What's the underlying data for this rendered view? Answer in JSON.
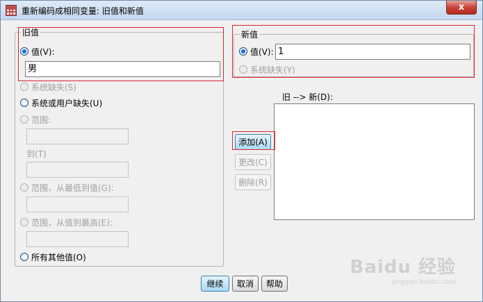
{
  "window": {
    "title": "重新编码成相同变量: 旧值和新值",
    "close_label": "x"
  },
  "old_value": {
    "legend": "旧值",
    "value_label": "值(V):",
    "value_input": "男",
    "system_missing_label": "系统缺失(S)",
    "system_or_user_missing_label": "系统或用户缺失(U)",
    "range_label": "范围:",
    "range_to_label": "到(T)",
    "range_lowest_label": "范围，从最低到值(G):",
    "range_highest_label": "范围，从值到最高(E):",
    "all_other_label": "所有其他值(O)"
  },
  "new_value": {
    "legend": "新值",
    "value_label": "值(V):",
    "value_input": "1",
    "system_missing_label": "系统缺失(Y)"
  },
  "mapping": {
    "list_label": "旧 --> 新(D):",
    "items": []
  },
  "buttons": {
    "add": "添加(A)",
    "change": "更改(C)",
    "remove": "删除(R)",
    "continue": "继续",
    "cancel": "取消",
    "help": "帮助"
  },
  "watermark": {
    "text": "Baidu 经验",
    "sub": "jingyan.baidu.com"
  },
  "colors": {
    "highlight": "#d9262f",
    "radio_dot": "#1a6ad6",
    "primary_button": "#a9d9f5"
  }
}
